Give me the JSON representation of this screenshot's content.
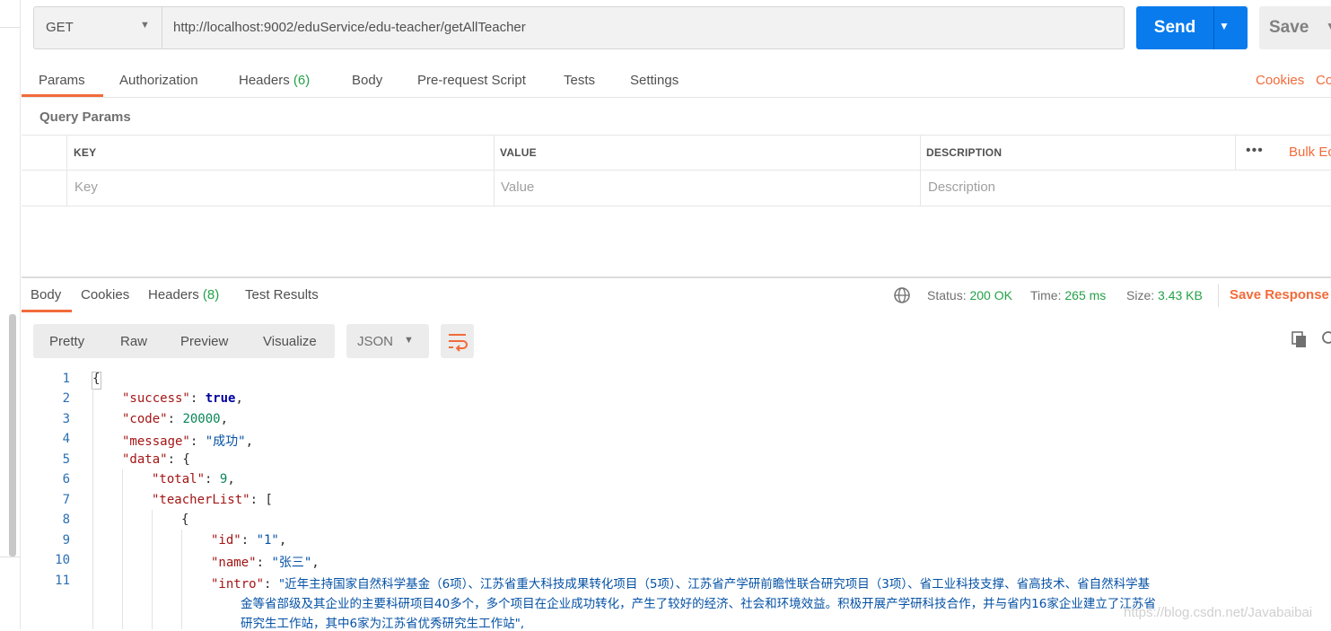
{
  "request": {
    "method": "GET",
    "url": "http://localhost:9002/eduService/edu-teacher/getAllTeacher",
    "send_label": "Send",
    "save_label": "Save"
  },
  "request_tabs": [
    {
      "label": "Params"
    },
    {
      "label": "Authorization"
    },
    {
      "label": "Headers",
      "count": "(6)"
    },
    {
      "label": "Body"
    },
    {
      "label": "Pre-request Script"
    },
    {
      "label": "Tests"
    },
    {
      "label": "Settings"
    }
  ],
  "right_links": {
    "cookies": "Cookies",
    "code": "Co"
  },
  "query_params": {
    "title": "Query Params",
    "headers": {
      "key": "KEY",
      "value": "VALUE",
      "description": "DESCRIPTION"
    },
    "placeholders": {
      "key": "Key",
      "value": "Value",
      "description": "Description"
    },
    "more": "•••",
    "bulk_edit": "Bulk Ec"
  },
  "response": {
    "tabs": [
      {
        "label": "Body"
      },
      {
        "label": "Cookies"
      },
      {
        "label": "Headers",
        "count": "(8)"
      },
      {
        "label": "Test Results"
      }
    ],
    "status_label": "Status:",
    "status_value": "200 OK",
    "time_label": "Time:",
    "time_value": "265 ms",
    "size_label": "Size:",
    "size_value": "3.43 KB",
    "save_response": "Save Response",
    "view_modes": [
      "Pretty",
      "Raw",
      "Preview",
      "Visualize"
    ],
    "format": "JSON"
  },
  "code": {
    "line_numbers": [
      "1",
      "2",
      "3",
      "4",
      "5",
      "6",
      "7",
      "8",
      "9",
      "10",
      "11"
    ],
    "l1": "{",
    "l2_key": "\"success\"",
    "l2_val": "true",
    "l3_key": "\"code\"",
    "l3_val": "20000",
    "l4_key": "\"message\"",
    "l4_val": "\"成功\"",
    "l5_key": "\"data\"",
    "l5_rest": ": {",
    "l6_key": "\"total\"",
    "l6_val": "9",
    "l7_key": "\"teacherList\"",
    "l7_rest": ": [",
    "l8": "{",
    "l9_key": "\"id\"",
    "l9_val": "\"1\"",
    "l10_key": "\"name\"",
    "l10_val": "\"张三\"",
    "l11_key": "\"intro\"",
    "l11_val_a": "\"近年主持国家自然科学基金（6项）、江苏省重大科技成果转化项目（5项）、江苏省产学研前瞻性联合研究项目（3项）、省工业科技支撑、省高技术、省自然科学基",
    "l11_val_b": "金等省部级及其企业的主要科研项目40多个，多个项目在企业成功转化，产生了较好的经济、社会和环境效益。积极开展产学研科技合作，并与省内16家企业建立了江苏省",
    "l11_val_c": "研究生工作站，其中6家为江苏省优秀研究生工作站\","
  },
  "watermark": "https://blog.csdn.net/Javabaibai"
}
